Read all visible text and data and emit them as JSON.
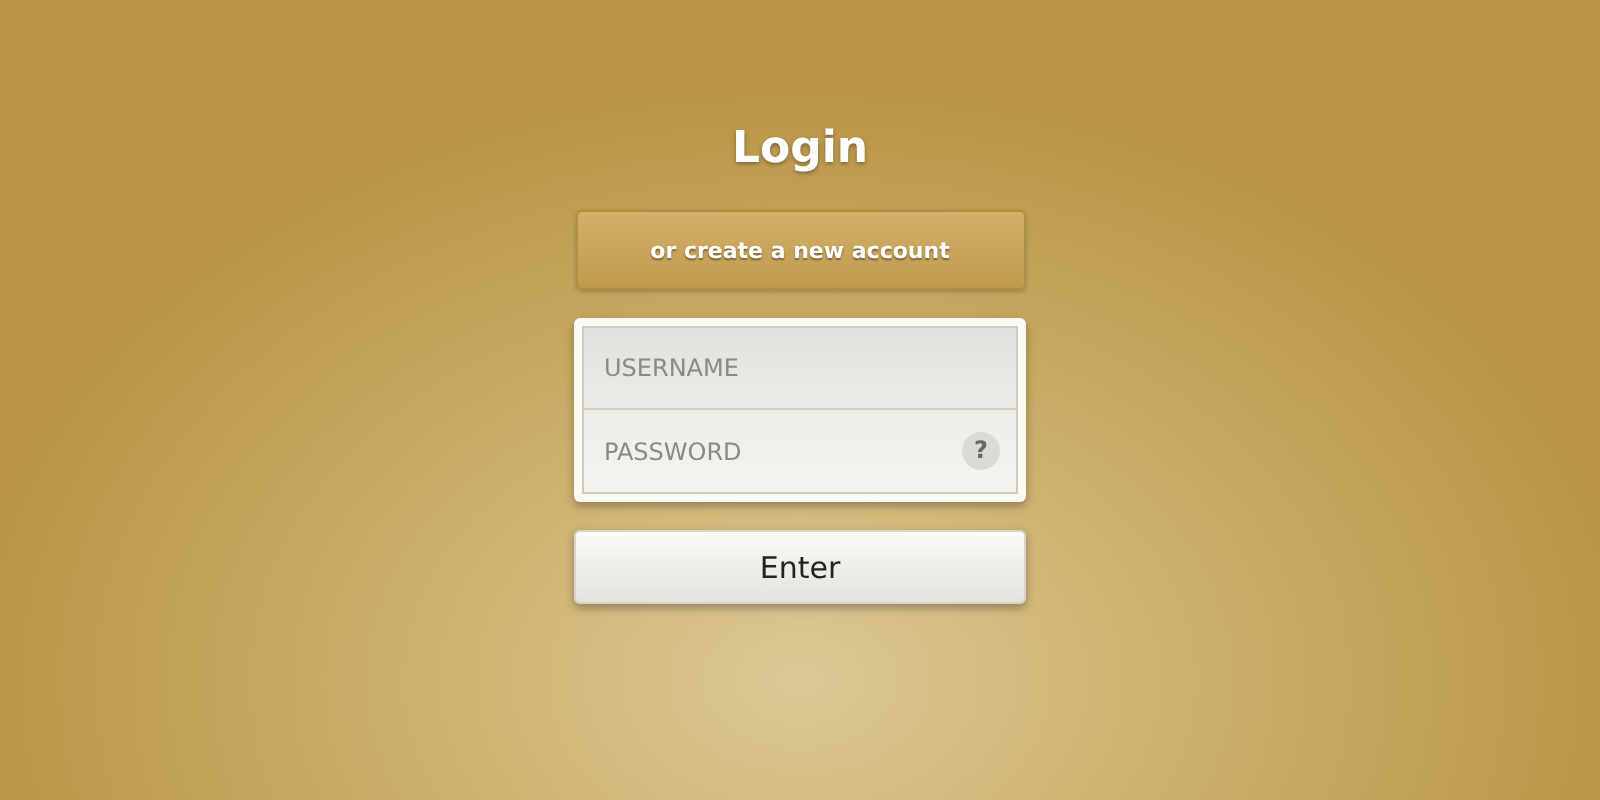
{
  "title": "Login",
  "create_account_button": "or create a new account",
  "fields": [
    {
      "placeholder": "USERNAME"
    },
    {
      "placeholder": "PASSWORD",
      "help": "?"
    }
  ],
  "submit_button": "Enter"
}
